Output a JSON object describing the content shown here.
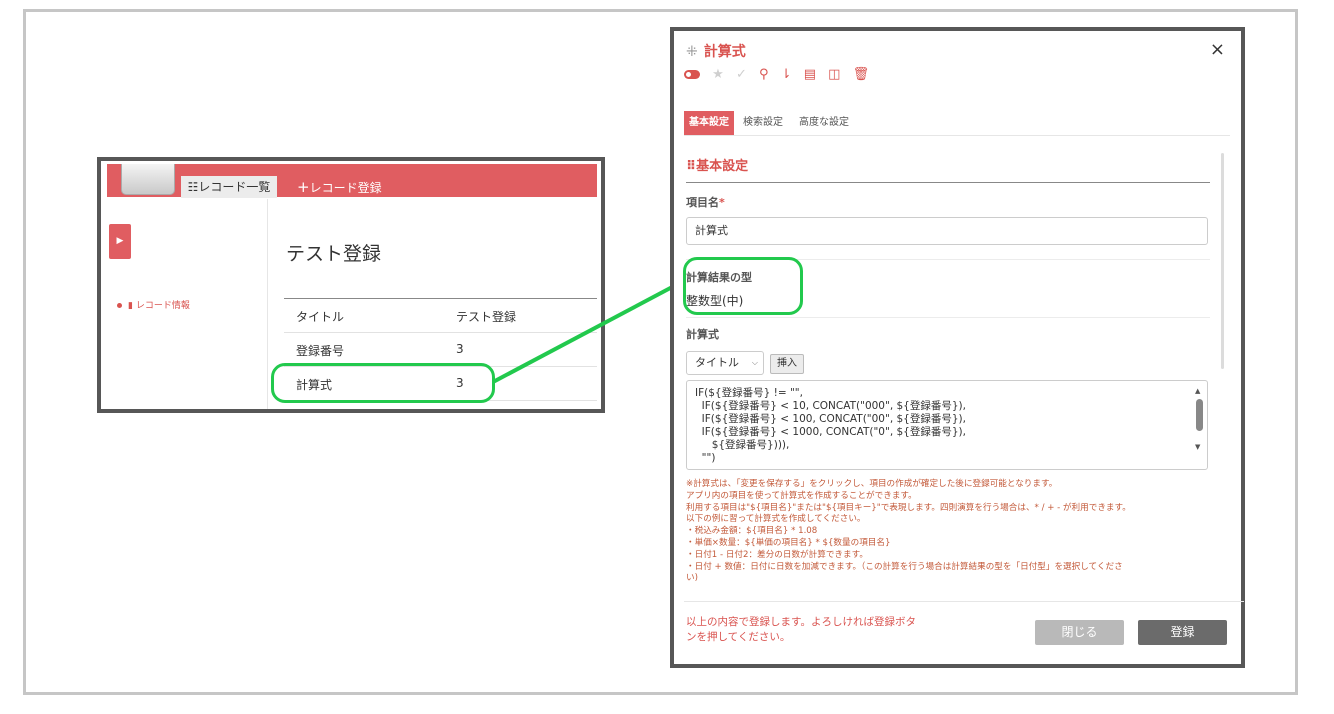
{
  "list_app": {
    "tabs": {
      "record_list": "レコード一覧",
      "add_record": "レコード登録"
    },
    "sidebar": {
      "item": "レコード情報"
    },
    "page_title": "テスト登録",
    "rows": [
      {
        "key": "タイトル",
        "value": "テスト登録"
      },
      {
        "key": "登録番号",
        "value": "3"
      },
      {
        "key": "計算式",
        "value": "3"
      }
    ]
  },
  "dialog": {
    "title": "計算式",
    "close": "×",
    "tabs": [
      "基本設定",
      "検索設定",
      "高度な設定"
    ],
    "section_title": "基本設定",
    "field_name_label": "項目名",
    "required_mark": "*",
    "field_name_value": "計算式",
    "result_type_label": "計算結果の型",
    "result_type_value": "整数型(中)",
    "formula_label": "計算式",
    "insert_select": "タイトル",
    "insert_button": "挿入",
    "formula_text": "IF(${登録番号} != \"\",\n  IF(${登録番号} < 10, CONCAT(\"000\", ${登録番号}),\n  IF(${登録番号} < 100, CONCAT(\"00\", ${登録番号}),\n  IF(${登録番号} < 1000, CONCAT(\"0\", ${登録番号}),\n     ${登録番号}))),\n  \"\")",
    "help_lines": [
      "※計算式は、「変更を保存する」をクリックし、項目の作成が確定した後に登録可能となります。",
      "アプリ内の項目を使って計算式を作成することができます。",
      "利用する項目は\"${項目名}\"または\"${項目キー}\"で表現します。四則演算を行う場合は、* / + - が利用できます。",
      "以下の例に習って計算式を作成してください。",
      "・税込み金額：${項目名} * 1.08",
      "・単価×数量：${単価の項目名} * ${数量の項目名}",
      "・日付1 - 日付2：差分の日数が計算できます。",
      "・日付 + 数値：日付に日数を加減できます。（この計算を行う場合は計算結果の型を「日付型」を選択してくださ",
      "い)"
    ],
    "footer_message": "以上の内容で登録します。よろしければ登録ボタンを押してください。",
    "btn_close": "閉じる",
    "btn_register": "登録"
  },
  "colors": {
    "accent": "#e05d61",
    "highlight": "#22c94d"
  }
}
